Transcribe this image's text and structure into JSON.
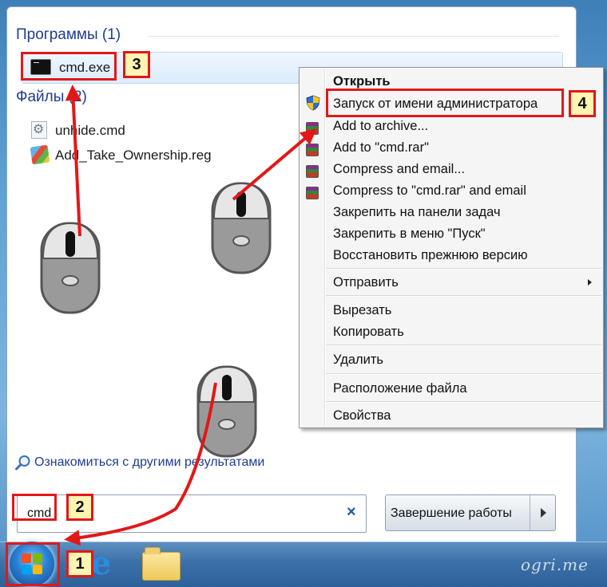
{
  "search_results": {
    "programs_header": "Программы (1)",
    "files_header": "Файлы (2)",
    "programs": [
      {
        "label": "cmd.exe",
        "icon": "cmd-icon"
      }
    ],
    "files": [
      {
        "label": "unhide.cmd",
        "icon": "gear-document-icon"
      },
      {
        "label": "Add_Take_Ownership.reg",
        "icon": "registry-file-icon"
      }
    ],
    "see_more": "Ознакомиться с другими результатами"
  },
  "search": {
    "value": "cmd",
    "clear_icon": "×"
  },
  "shutdown": {
    "label": "Завершение работы"
  },
  "context_menu": {
    "open": "Открыть",
    "run_as_admin": "Запуск от имени администратора",
    "add_to_archive": "Add to archive...",
    "add_to_rar": "Add to \"cmd.rar\"",
    "compress_email": "Compress and email...",
    "compress_rar_email": "Compress to \"cmd.rar\" and email",
    "pin_taskbar": "Закрепить на панели задач",
    "pin_start": "Закрепить в меню \"Пуск\"",
    "restore_previous": "Восстановить прежнюю версию",
    "send_to": "Отправить",
    "cut": "Вырезать",
    "copy": "Копировать",
    "delete": "Удалить",
    "file_location": "Расположение файла",
    "properties": "Свойства"
  },
  "annotations": {
    "step1": "1",
    "step2": "2",
    "step3": "3",
    "step4": "4"
  },
  "watermark": "ogri.me",
  "colors": {
    "annotation_red": "#e21818",
    "badge_fill": "#fff5b2",
    "header_blue": "#1e3d8f"
  }
}
